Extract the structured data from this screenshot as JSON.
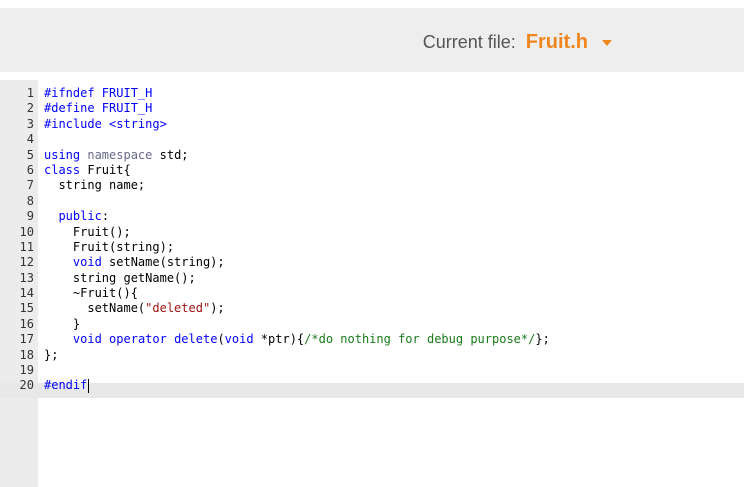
{
  "header": {
    "file_label": "Current file:",
    "file_name": "Fruit.h",
    "dropdown_icon": "chevron-down-icon",
    "accent_color": "#f0871d"
  },
  "editor": {
    "line_numbers": [
      "1",
      "2",
      "3",
      "4",
      "5",
      "6",
      "7",
      "8",
      "9",
      "10",
      "11",
      "12",
      "13",
      "14",
      "15",
      "16",
      "17",
      "18",
      "19",
      "20"
    ],
    "lines": [
      "#ifndef FRUIT_H",
      "#define FRUIT_H",
      "#include <string>",
      "",
      "using namespace std;",
      "class Fruit{",
      "  string name;",
      "",
      "  public:",
      "    Fruit();",
      "    Fruit(string);",
      "    void setName(string);",
      "    string getName();",
      "    ~Fruit(){",
      "      setName(\"deleted\");",
      "    }",
      "    void operator delete(void *ptr){/*do nothing for debug purpose*/};",
      "};",
      "",
      "#endif"
    ],
    "active_line": 20
  }
}
